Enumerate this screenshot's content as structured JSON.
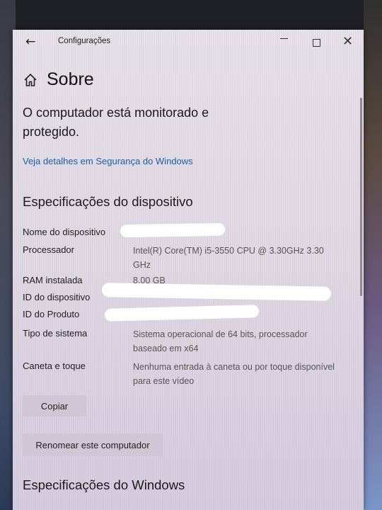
{
  "window": {
    "title": "Configurações"
  },
  "header": {
    "title": "Sobre"
  },
  "status": {
    "text": "O computador está monitorado e protegido.",
    "link": "Veja detalhes em Segurança do Windows"
  },
  "device_specs": {
    "title": "Especificações do dispositivo",
    "rows": [
      {
        "label": "Nome do dispositivo",
        "value": ""
      },
      {
        "label": "Processador",
        "value": "Intel(R) Core(TM) i5-3550 CPU @ 3.30GHz 3.30 GHz"
      },
      {
        "label": "RAM instalada",
        "value": "8,00 GB"
      },
      {
        "label": "ID do dispositivo",
        "value": ""
      },
      {
        "label": "ID do Produto",
        "value": ""
      },
      {
        "label": "Tipo de sistema",
        "value": "Sistema operacional de 64 bits, processador baseado em x64"
      },
      {
        "label": "Caneta e toque",
        "value": "Nenhuma entrada à caneta ou por toque disponível para este vídeo"
      }
    ]
  },
  "buttons": {
    "copy": "Copiar",
    "rename": "Renomear este computador"
  },
  "windows_specs": {
    "title": "Especificações do Windows"
  }
}
